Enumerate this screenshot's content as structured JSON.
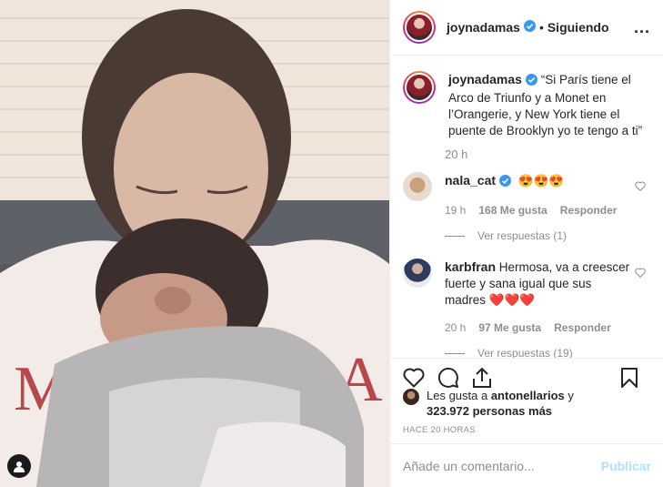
{
  "header": {
    "username": "joynadamas",
    "separator": "•",
    "follow_status": "Siguiendo",
    "more": "..."
  },
  "caption": {
    "username": "joynadamas",
    "text": "“Si París tiene el Arco de Triunfo y a Monet en l’Orangerie, y New York tiene el puente de Brooklyn yo te tengo a ti”",
    "time": "20 h"
  },
  "comments": [
    {
      "username": "nala_cat",
      "verified": true,
      "text": "😍😍😍",
      "time": "19 h",
      "likes": "168 Me gusta",
      "reply": "Responder",
      "view_replies": "Ver respuestas (1)"
    },
    {
      "username": "karbfran",
      "verified": false,
      "text": "Hermosa, va a creescer fuerte y sana igual que sus madres ❤️❤️❤️",
      "time": "20 h",
      "likes": "97 Me gusta",
      "reply": "Responder",
      "view_replies": "Ver respuestas (19)"
    }
  ],
  "likes": {
    "prefix": "Les gusta a ",
    "user": "antonellarios",
    "middle": " y",
    "count": "323.972 personas más"
  },
  "posted": "HACE 20 HORAS",
  "comment_input": {
    "placeholder": "Añade un comentario...",
    "publish": "Publicar"
  },
  "colors": {
    "link_disabled": "#b2dffc",
    "meta_gray": "#8e8e8e",
    "verified_blue": "#3897f0"
  },
  "icons": [
    "heart-icon",
    "comment-icon",
    "share-icon",
    "bookmark-icon",
    "verified-badge-icon",
    "user-tag-icon",
    "more-icon"
  ]
}
